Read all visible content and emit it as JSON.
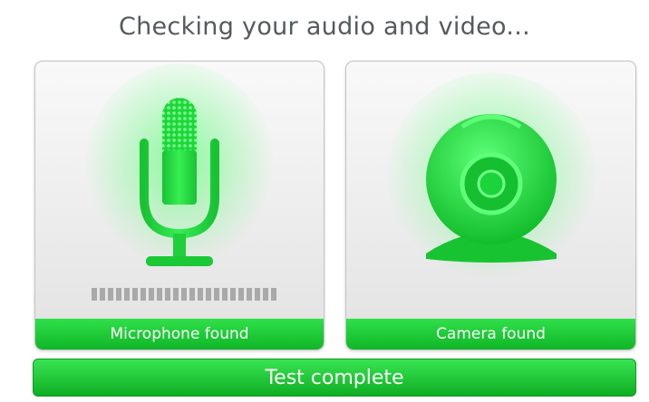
{
  "header": {
    "title": "Checking your audio and video..."
  },
  "microphone": {
    "status_label": "Microphone found",
    "icon": "microphone-icon",
    "level_fraction": 0
  },
  "camera": {
    "status_label": "Camera found",
    "icon": "webcam-icon"
  },
  "footer": {
    "status_label": "Test complete"
  },
  "colors": {
    "accent": "#22c93a",
    "icon_green": "#1fd43c",
    "meter_idle": "#a9a9a9"
  }
}
